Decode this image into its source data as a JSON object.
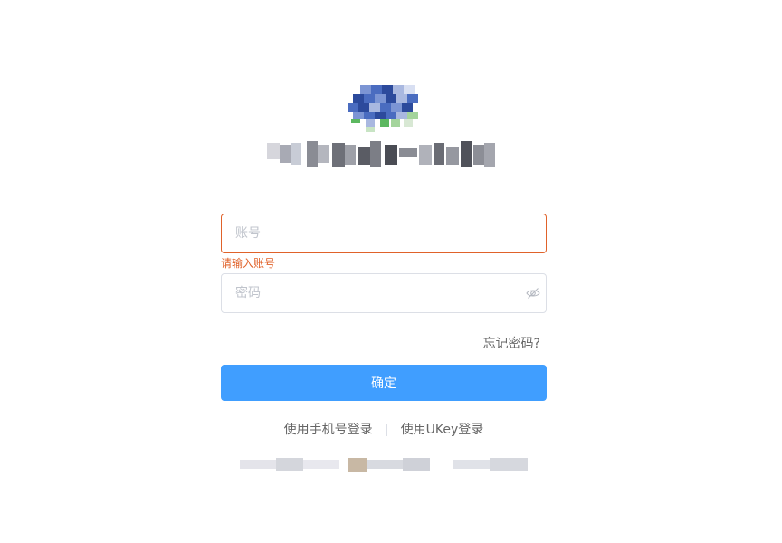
{
  "logo": {
    "icon": "organization-logo-icon",
    "colors": [
      "#2c4a9c",
      "#4a6cc0",
      "#7c95d4",
      "#a9b8e0",
      "#5cb860",
      "#a4d49c"
    ]
  },
  "org_name": {
    "obscured": true
  },
  "login": {
    "account_placeholder": "账号",
    "account_error": "请输入账号",
    "password_placeholder": "密码",
    "password_toggle_icon": "eye-slash-icon",
    "forgot_password": "忘记密码?",
    "submit_label": "确定"
  },
  "alt_login": {
    "phone_login": "使用手机号登录",
    "ukey_login": "使用UKey登录"
  },
  "footer": {
    "obscured": true
  },
  "colors": {
    "primary": "#409eff",
    "error": "#e0622a",
    "border": "#dcdfe6",
    "muted": "#666666"
  }
}
